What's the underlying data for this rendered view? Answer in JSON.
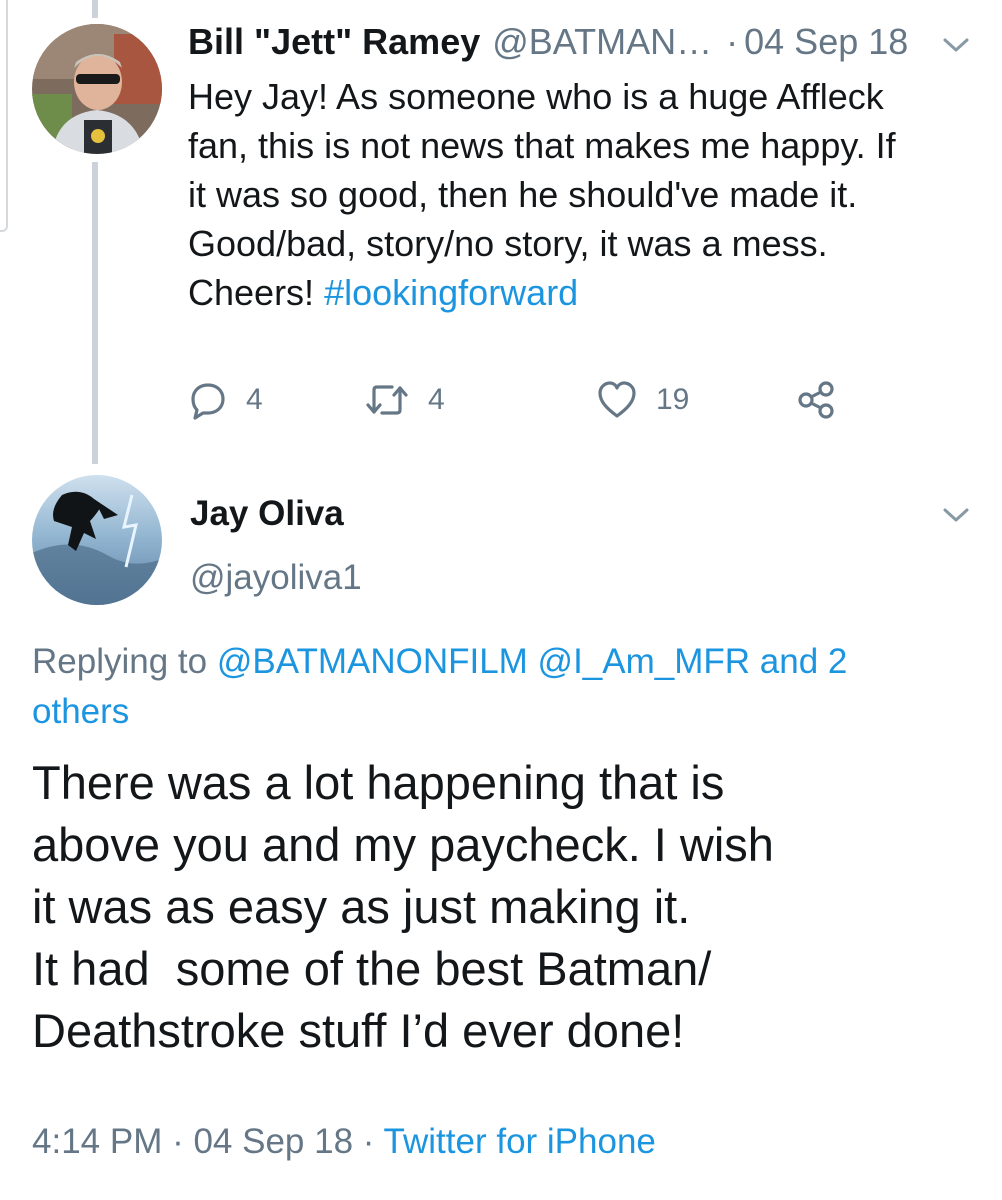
{
  "tweet1": {
    "name": "Bill \"Jett\" Ramey",
    "handle": "@BATMAN…",
    "separator": "·",
    "date": "04 Sep 18",
    "body_lines": [
      "Hey Jay!  As someone who is a huge Affleck",
      "fan, this is not news that makes me happy.  If",
      "it was so good, then he should've made it.",
      "Good/bad, story/no story, it was a mess."
    ],
    "body_last_line_prefix": "Cheers! ",
    "hashtag": "#lookingforward",
    "actions": {
      "reply_count": "4",
      "retweet_count": "4",
      "like_count": "19"
    },
    "icons": [
      "reply-icon",
      "retweet-icon",
      "like-icon",
      "share-icon",
      "chevron-down-icon"
    ]
  },
  "tweet2": {
    "name": "Jay Oliva",
    "handle": "@jayoliva1",
    "replying_prefix": "Replying to ",
    "replying_mentions": "@BATMANONFILM @I_Am_MFR and 2",
    "replying_others": "others",
    "body_lines": [
      "There was a lot happening that is",
      "above you and my paycheck. I wish",
      "it was as easy as just making it.",
      "It had  some of the best Batman/",
      "Deathstroke stuff I’d ever done!"
    ],
    "time": "4:14 PM",
    "separator1": " · ",
    "date": "04 Sep 18",
    "separator2": " · ",
    "source": "Twitter for iPhone"
  },
  "colors": {
    "text": "#14171a",
    "secondary": "#657786",
    "link": "#1b95e0",
    "thread_line": "#cbd2d9"
  }
}
